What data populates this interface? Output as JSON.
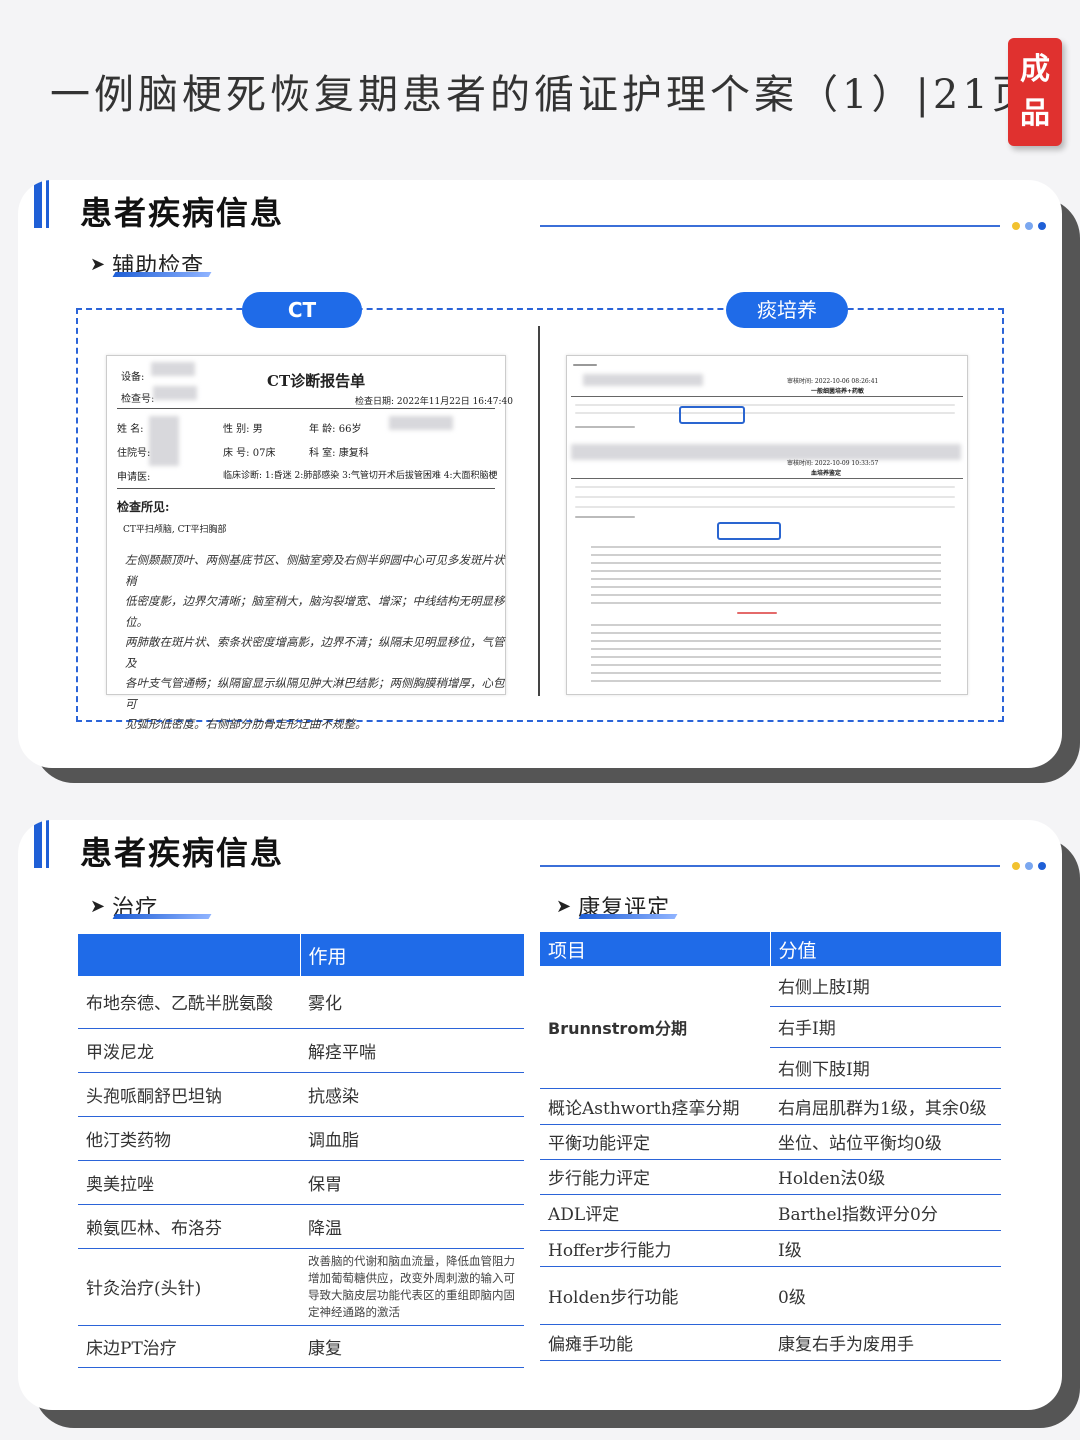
{
  "page_title": "一例脑梗死恢复期患者的循证护理个案（1）|21页",
  "stamp": {
    "line1": "成",
    "line2": "品"
  },
  "colors": {
    "accent": "#1f6be8",
    "stamp": "#e0312f",
    "dots": [
      "#f2c230",
      "#7aa7f0",
      "#1f5fd6"
    ]
  },
  "card1": {
    "section_title": "患者疾病信息",
    "subsection": "辅助检查",
    "left_label": "CT",
    "right_label": "痰培养",
    "ct_report": {
      "device_label": "设备:",
      "exam_no_label": "检查号:",
      "report_title": "CT诊断报告单",
      "exam_date": "检查日期: 2022年11月22日 16:47:40",
      "name_label": "姓 名:",
      "gender": "性 别: 男",
      "age": "年 龄: 66岁",
      "inpatient_label": "住院号:",
      "bed": "床 号: 07床",
      "dept": "科 室: 康复科",
      "applicant_label": "申请医:",
      "diagnosis": "临床诊断: 1:昏迷 2:肺部感染 3:气管切开术后拔管困难 4:大面积脑梗",
      "findings_label": "检查所见:",
      "scan_type": "CT平扫颅脑, CT平扫胸部",
      "findings_lines": [
        "左侧颞颞顶叶、两侧基底节区、侧脑室旁及右侧半卵圆中心可见多发斑片状稍",
        "低密度影，边界欠清晰；脑室稍大，脑沟裂增宽、增深；中线结构无明显移",
        "位。",
        "两肺散在斑片状、索条状密度增高影，边界不清；纵隔未见明显移位，气管及",
        "各叶支气管通畅；纵隔窗显示纵隔见肿大淋巴结影；两侧胸膜稍增厚，心包可",
        "见弧形低密度。右侧部分肋骨走形迂曲不规整。"
      ]
    },
    "culture_report": {
      "time1": "审核时间: 2022-10-06 08:26:41",
      "title1": "一般细菌培养+药敏",
      "time2": "审核时间: 2022-10-09 10:33:57",
      "title2": "血培养鉴定"
    }
  },
  "card2": {
    "section_title": "患者疾病信息",
    "treatment": {
      "subsection": "治疗",
      "headers": [
        "",
        "作用"
      ],
      "rows": [
        {
          "drug": "布地奈德、乙酰半胱氨酸",
          "effect": "雾化"
        },
        {
          "drug": "甲泼尼龙",
          "effect": "解痉平喘"
        },
        {
          "drug": "头孢哌酮舒巴坦钠",
          "effect": "抗感染"
        },
        {
          "drug": "他汀类药物",
          "effect": "调血脂"
        },
        {
          "drug": "奥美拉唑",
          "effect": "保胃"
        },
        {
          "drug": "赖氨匹林、布洛芬",
          "effect": "降温"
        },
        {
          "drug": "针灸治疗(头针)",
          "effect": "改善脑的代谢和脑血流量，降低血管阻力增加葡萄糖供应，改变外周刺激的输入可导致大脑皮层功能代表区的重组即脑内固定神经通路的激活"
        },
        {
          "drug": "床边PT治疗",
          "effect": "康复"
        }
      ]
    },
    "rehab": {
      "subsection": "康复评定",
      "headers": [
        "项目",
        "分值"
      ],
      "brunnstrom_label": "Brunnstrom分期",
      "brunnstrom_values": [
        "右侧上肢I期",
        "右手I期",
        "右侧下肢I期"
      ],
      "rows": [
        {
          "item": "概论Asthworth痉挛分期",
          "value": "右肩屈肌群为1级，其余0级"
        },
        {
          "item": "平衡功能评定",
          "value": "坐位、站位平衡均0级"
        },
        {
          "item": "步行能力评定",
          "value": "Holden法0级"
        },
        {
          "item": "ADL评定",
          "value": "Barthel指数评分0分"
        },
        {
          "item": "Hoffer步行能力",
          "value": "I级"
        },
        {
          "item": "Holden步行功能",
          "value": "0级"
        },
        {
          "item": "偏瘫手功能",
          "value": "康复右手为废用手"
        }
      ]
    }
  }
}
